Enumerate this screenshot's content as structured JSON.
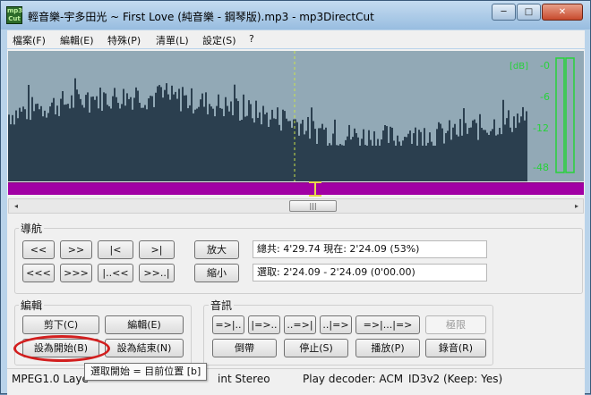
{
  "window": {
    "title": "輕音樂-宇多田光 ~ First Love (純音樂 - 鋼琴版).mp3 - mp3DirectCut",
    "icon_text_top": "mp3",
    "icon_text_bottom": "Cut",
    "controls": {
      "minimize": "─",
      "maximize": "□",
      "close": "✕"
    }
  },
  "menu": [
    "檔案(F)",
    "編輯(E)",
    "特殊(P)",
    "清單(L)",
    "設定(S)",
    "?"
  ],
  "waveform": {
    "background": "#92a9b6",
    "wave_color": "#2b3f4f",
    "cursor_color": "#c9e24a",
    "meter_labels": [
      "[dB]",
      "-0",
      "-6",
      "-12",
      "-48"
    ],
    "meter_color": "#27d23a"
  },
  "selection_bar_color": "#a100a4",
  "scrollbar": {
    "thumb_glyph": "|||",
    "left_arrow": "◂",
    "right_arrow": "▸"
  },
  "navigation": {
    "label": "導航",
    "buttons_row1": [
      "<<",
      ">>",
      "|<",
      ">|"
    ],
    "buttons_row2": [
      "<<<",
      ">>>",
      "|..<<",
      ">>..|"
    ],
    "zoom_in": "放大",
    "zoom_out": "縮小",
    "info_total": "總共: 4'29.74   現在: 2'24.09   (53%)",
    "info_selection": "選取: 2'24.09 - 2'24.09 (0'00.00)"
  },
  "edit": {
    "label": "編輯",
    "cut": "剪下(C)",
    "edit": "編輯(E)",
    "set_start": "設為開始(B)",
    "set_end": "設為結束(N)"
  },
  "audio": {
    "label": "音訊",
    "row1": [
      "=>|..",
      "|=>..",
      "..=>|",
      "..|=>",
      "=>|...|=>"
    ],
    "limit": "極限",
    "rewind": "倒帶",
    "stop": "停止(S)",
    "play": "播放(P)",
    "record": "錄音(R)"
  },
  "status": {
    "format": "MPEG1.0 Laye",
    "channel": "int Stereo",
    "decoder": "Play decoder: ACM",
    "id3": "ID3v2 (Keep: Yes)"
  },
  "tooltip": "選取開始 = 目前位置   [b]",
  "highlight_color": "#d21f1f"
}
